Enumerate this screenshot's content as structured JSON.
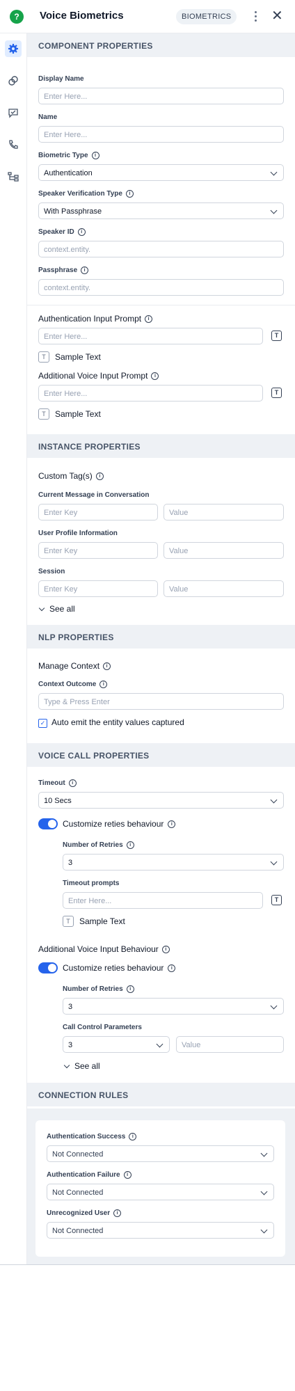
{
  "header": {
    "title": "Voice Biometrics",
    "badge": "BIOMETRICS",
    "more_icon": "kebab-icon",
    "close": "✕"
  },
  "nav": {
    "items": [
      "gear-icon",
      "link-icon",
      "chat-check-icon",
      "phone-icon",
      "flow-icon"
    ]
  },
  "component": {
    "section": "COMPONENT PROPERTIES",
    "display_name_label": "Display Name",
    "display_name_ph": "Enter Here...",
    "name_label": "Name",
    "name_ph": "Enter Here...",
    "biometric_type_label": "Biometric Type",
    "biometric_type_value": "Authentication",
    "speaker_ver_label": "Speaker Verification Type",
    "speaker_ver_value": "With Passphrase",
    "speaker_id_label": "Speaker ID",
    "speaker_id_ph": "context.entity.",
    "passphrase_label": "Passphrase",
    "passphrase_ph": "context.entity.",
    "auth_prompt_label": "Authentication Input Prompt",
    "auth_prompt_ph": "Enter Here...",
    "sample_text": "Sample Text",
    "add_voice_prompt_label": "Additional Voice Input Prompt",
    "add_voice_prompt_ph": "Enter Here...",
    "t_glyph": "T"
  },
  "instance": {
    "section": "INSTANCE PROPERTIES",
    "custom_tags": "Custom Tag(s)",
    "current_msg": "Current Message in Conversation",
    "user_profile": "User Profile Information",
    "session": "Session",
    "key_ph": "Enter Key",
    "value_ph": "Value",
    "see_all": "See all"
  },
  "nlp": {
    "section": "NLP PROPERTIES",
    "manage_context": "Manage Context",
    "context_outcome": "Context Outcome",
    "context_ph": "Type & Press Enter",
    "auto_emit": "Auto emit the entity values captured",
    "check": "✓"
  },
  "voice": {
    "section": "VOICE CALL PROPERTIES",
    "timeout_label": "Timeout",
    "timeout_value": "10 Secs",
    "customize_retries": "Customize reties behaviour",
    "num_retries_label": "Number of Retries",
    "num_retries_value": "3",
    "timeout_prompts_label": "Timeout prompts",
    "timeout_prompts_ph": "Enter Here...",
    "sample_text": "Sample Text",
    "add_voice_behaviour": "Additional Voice Input Behaviour",
    "customize_retries_2": "Customize reties behaviour",
    "num_retries_label_2": "Number of Retries",
    "num_retries_value_2": "3",
    "call_control_label": "Call Control Parameters",
    "call_control_value": "3",
    "call_control_value_ph": "Value",
    "see_all": "See all"
  },
  "connection": {
    "section": "CONNECTION RULES",
    "auth_success": "Authentication Success",
    "auth_failure": "Authentication Failure",
    "unrecognized": "Unrecognized User",
    "not_connected": "Not Connected"
  }
}
